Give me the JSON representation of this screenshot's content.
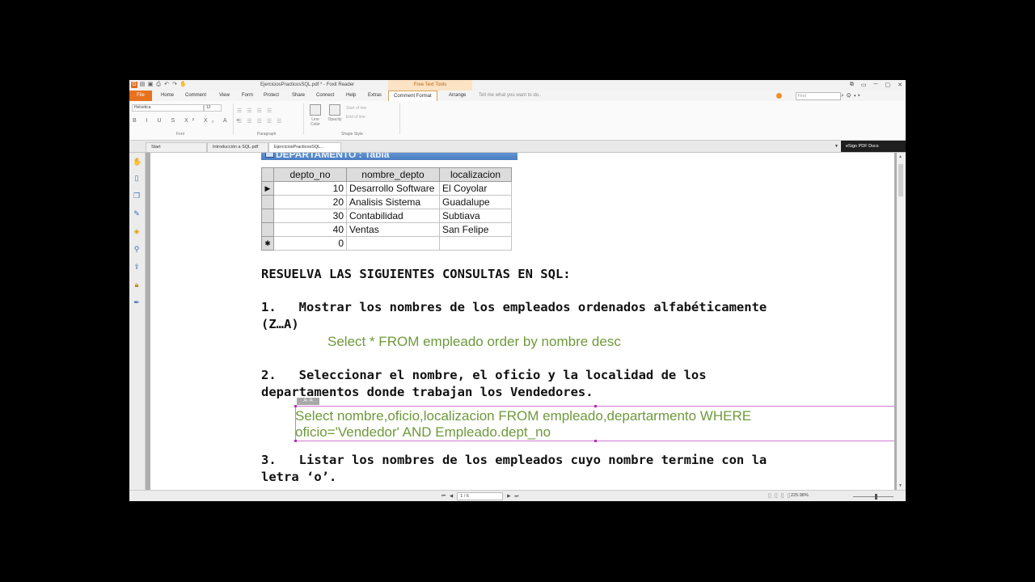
{
  "window": {
    "title": "EjerciciosPracticosSQL.pdf * - Foxit Reader",
    "contextual_tab": "Free Text Tools",
    "controls": [
      "⧉",
      "▭",
      "─",
      "▢",
      "✕"
    ]
  },
  "ribbon_tabs": {
    "file": "File",
    "home": "Home",
    "comment": "Comment",
    "view": "View",
    "form": "Form",
    "protect": "Protect",
    "share": "Share",
    "connect": "Connect",
    "help": "Help",
    "extras": "Extras",
    "comment_format": "Comment Format",
    "arrange": "Arrange",
    "tell_me": "Tell me what you want to do..",
    "find_placeholder": "Find"
  },
  "ribbon": {
    "font_name": "Helvetica",
    "font_size": "12",
    "format_buttons": "B I U S X² X₂ A ≡",
    "group_font": "Font",
    "group_paragraph": "Paragraph",
    "group_shape": "Shape Style",
    "line_color": "Line Color",
    "opacity": "Opacity",
    "start_of_line": "Start of line",
    "end_of_line": "End of line"
  },
  "doc_tabs": {
    "start": "Start",
    "tab1": "Introducción a SQL.pdf",
    "tab2": "EjerciciosPracticosSQL...",
    "esign": "eSign PDF Docs"
  },
  "table": {
    "title": "DEPARTAMENTO : Tabla",
    "headers": [
      "depto_no",
      "nombre_depto",
      "localizacion"
    ],
    "rows": [
      [
        "10",
        "Desarrollo Software",
        "El Coyolar"
      ],
      [
        "20",
        "Analisis Sistema",
        "Guadalupe"
      ],
      [
        "30",
        "Contabilidad",
        "Subtiava"
      ],
      [
        "40",
        "Ventas",
        "San Felipe"
      ]
    ],
    "new_row_value": "0"
  },
  "document": {
    "heading": "RESUELVA LAS SIGUIENTES CONSULTAS EN SQL:",
    "q1_line1": "1.   Mostrar los nombres de los empleados ordenados alfabéticamente",
    "q1_line2": "(Z…A)",
    "a1": "Select * FROM empleado order by nombre desc",
    "q2_line1": "2.   Seleccionar el nombre, el oficio y la localidad de los",
    "q2_line2": "departamentos donde trabajan los Vendedores.",
    "a2_line1": "Select nombre,oficio,localizacion FROM empleado,departarmento WHERE",
    "a2_line2": "oficio='Vendedor' AND Empleado.dept_no",
    "q3_line1": "3.   Listar los nombres de los empleados cuyo nombre termine con la",
    "q3_line2": "letra ‘o’."
  },
  "status": {
    "page": "1 / 6",
    "zoom": "225.98%"
  },
  "colors": {
    "accent": "#e8711e",
    "answer_text": "#6e9a3a",
    "table_header": "#4a7cc0",
    "selection": "#d07ad0"
  }
}
